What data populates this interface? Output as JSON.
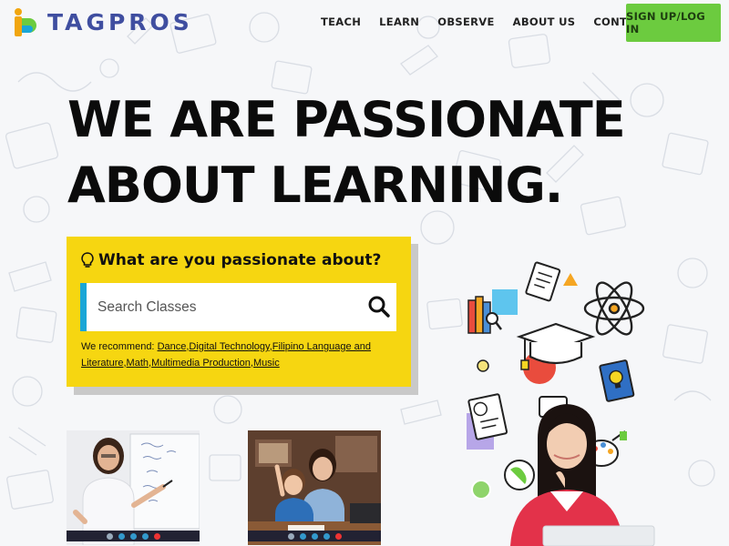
{
  "brand": {
    "name": "TAGPROS",
    "logo_icon": "tagpros-logo-icon",
    "colors": {
      "primary": "#3f4ea0",
      "accent_green": "#6ccb3f",
      "accent_yellow": "#f6d611",
      "accent_blue": "#1aa6d6"
    }
  },
  "nav": {
    "items": [
      {
        "label": "TEACH"
      },
      {
        "label": "LEARN"
      },
      {
        "label": "OBSERVE"
      },
      {
        "label": "ABOUT US"
      },
      {
        "label": "CONTACT US"
      }
    ],
    "cta_label": "SIGN UP/LOG IN"
  },
  "hero": {
    "line1": "WE ARE PASSIONATE",
    "line2": "ABOUT LEARNING."
  },
  "search": {
    "question": "What are you passionate about?",
    "question_icon": "lightbulb-icon",
    "placeholder": "Search Classes",
    "button_icon": "search-icon",
    "recommend_prefix": "We recommend: ",
    "recommendations": [
      "Dance",
      "Digital Technology",
      "Filipino Language and Literature",
      "Math",
      "Multimedia Production",
      "Music"
    ]
  },
  "thumbnails": [
    {
      "name": "teacher-whiteboard-video-thumb"
    },
    {
      "name": "parent-child-video-thumb"
    }
  ]
}
